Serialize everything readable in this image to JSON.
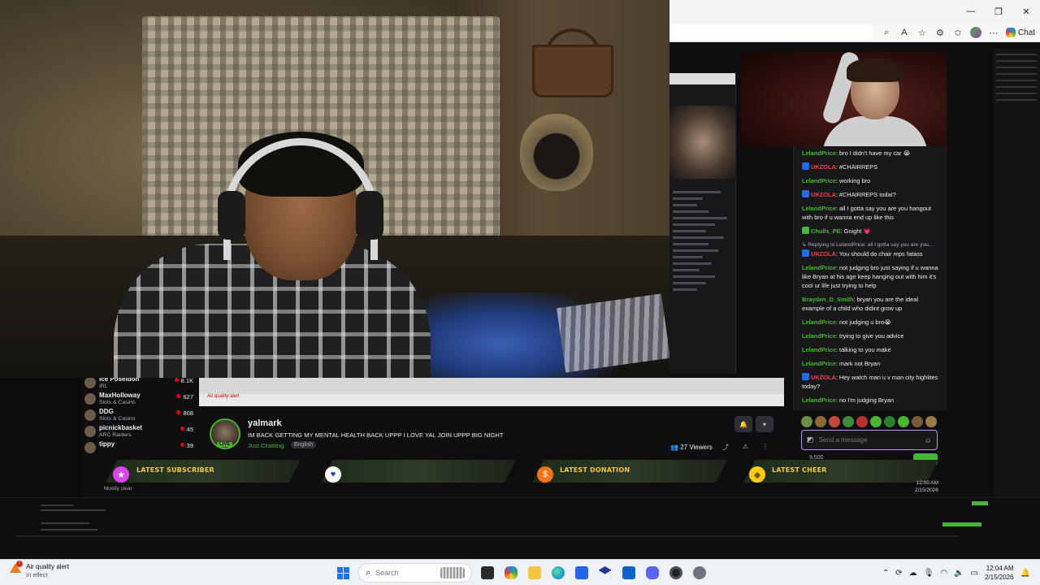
{
  "browser": {
    "chat_label": "Chat",
    "window_controls": [
      "minimize-icon",
      "restore-icon",
      "close-icon"
    ],
    "toolbar_icons": [
      "zoom-icon",
      "read-aloud-icon",
      "favorite-icon",
      "extensions-icon",
      "favorites-bar-icon",
      "profile-avatar",
      "more-icon"
    ]
  },
  "chat": {
    "messages": [
      {
        "user": "LelandPrice",
        "user_color": "#49b535",
        "text": "bro I didn't have my car 😭",
        "badge": false
      },
      {
        "user": "UKZOLA",
        "user_color": "#e54848",
        "text": "#CHAIRREPS",
        "badge": true
      },
      {
        "user": "LelandPrice",
        "user_color": "#49b535",
        "text": "working bro",
        "badge": false
      },
      {
        "user": "UKZOLA",
        "user_color": "#e54848",
        "text": "#CHAIRREPS todat?",
        "badge": true
      },
      {
        "user": "LelandPrice",
        "user_color": "#49b535",
        "text": "all I gotta say you are you hangout with bro if u wanna end up like this",
        "badge": false
      },
      {
        "user": "Chulls_PE",
        "user_color": "#49b535",
        "text": "Gnight 💗",
        "badge": true,
        "badge_color": "#49b535"
      },
      {
        "user": "UKZOLA",
        "user_color": "#e54848",
        "text": "You should do chair reps fatass",
        "badge": true,
        "reply": "Replying to LelandPrice: all I gotta say you are you..."
      },
      {
        "user": "LelandPrice",
        "user_color": "#49b535",
        "text": "not judging bro just saying if u wanna like Bryan at his age keep hanging out with him it's cool ur life just trying to help",
        "badge": false
      },
      {
        "user": "Brayden_D_Smith",
        "user_color": "#49b535",
        "text": "bryan you are the ideal example of a child who didint grow up",
        "badge": false
      },
      {
        "user": "LelandPrice",
        "user_color": "#49b535",
        "text": "not judging u bro😭",
        "badge": false
      },
      {
        "user": "LelandPrice",
        "user_color": "#49b535",
        "text": "trying to give you advice",
        "badge": false
      },
      {
        "user": "LelandPrice",
        "user_color": "#49b535",
        "text": "talking to you make",
        "badge": false
      },
      {
        "user": "LelandPrice",
        "user_color": "#49b535",
        "text": "mark not Bryan",
        "badge": false
      },
      {
        "user": "UKZOLA",
        "user_color": "#e54848",
        "text": "Hey watch man u v man city highlites today?",
        "badge": true
      },
      {
        "user": "LelandPrice",
        "user_color": "#49b535",
        "text": "no I'm judging Bryan",
        "badge": false
      }
    ],
    "input_placeholder": "Send a message",
    "points": "9,500"
  },
  "sidebar": {
    "channels": [
      {
        "name": "Ice Poseidon",
        "category": "IRL",
        "viewers": "8.1K"
      },
      {
        "name": "MaxHolloway",
        "category": "Slots & Casino",
        "viewers": "627"
      },
      {
        "name": "DDG",
        "category": "Slots & Casino",
        "viewers": "808"
      },
      {
        "name": "picnickbasket",
        "category": "ARC Raiders",
        "viewers": "45"
      },
      {
        "name": "tippy",
        "category": "",
        "viewers": "39"
      }
    ]
  },
  "stream": {
    "channel": "yalmark",
    "live_badge": "LIVE",
    "title": "IM BACK GETTING MY MENTAL HEALTH BACK UPPP I LOVE YAL JOIN UPPP BIG NIGHT",
    "category": "Just Chatting",
    "language": "English",
    "viewers": "27 Viewers",
    "embedded_alert": "Air quality alert"
  },
  "overlay": {
    "latest_subscriber": "LATEST SUBSCRIBER",
    "latest_donation": "LATEST DONATION",
    "latest_cheer": "LATEST CHEER",
    "weather": "Mostly clear",
    "small_time": "12:03 AM",
    "small_date": "2/15/2026"
  },
  "taskbar": {
    "alert_title": "Air quality alert",
    "alert_subtitle": "In effect",
    "search_placeholder": "Search",
    "time": "12:04 AM",
    "date": "2/15/2026",
    "apps": [
      "file-explorer-icon",
      "copilot-icon",
      "folder-icon",
      "edge-icon",
      "store-icon",
      "dropbox-icon",
      "outlook-icon",
      "discord-icon",
      "obs-icon",
      "settings-icon"
    ]
  }
}
